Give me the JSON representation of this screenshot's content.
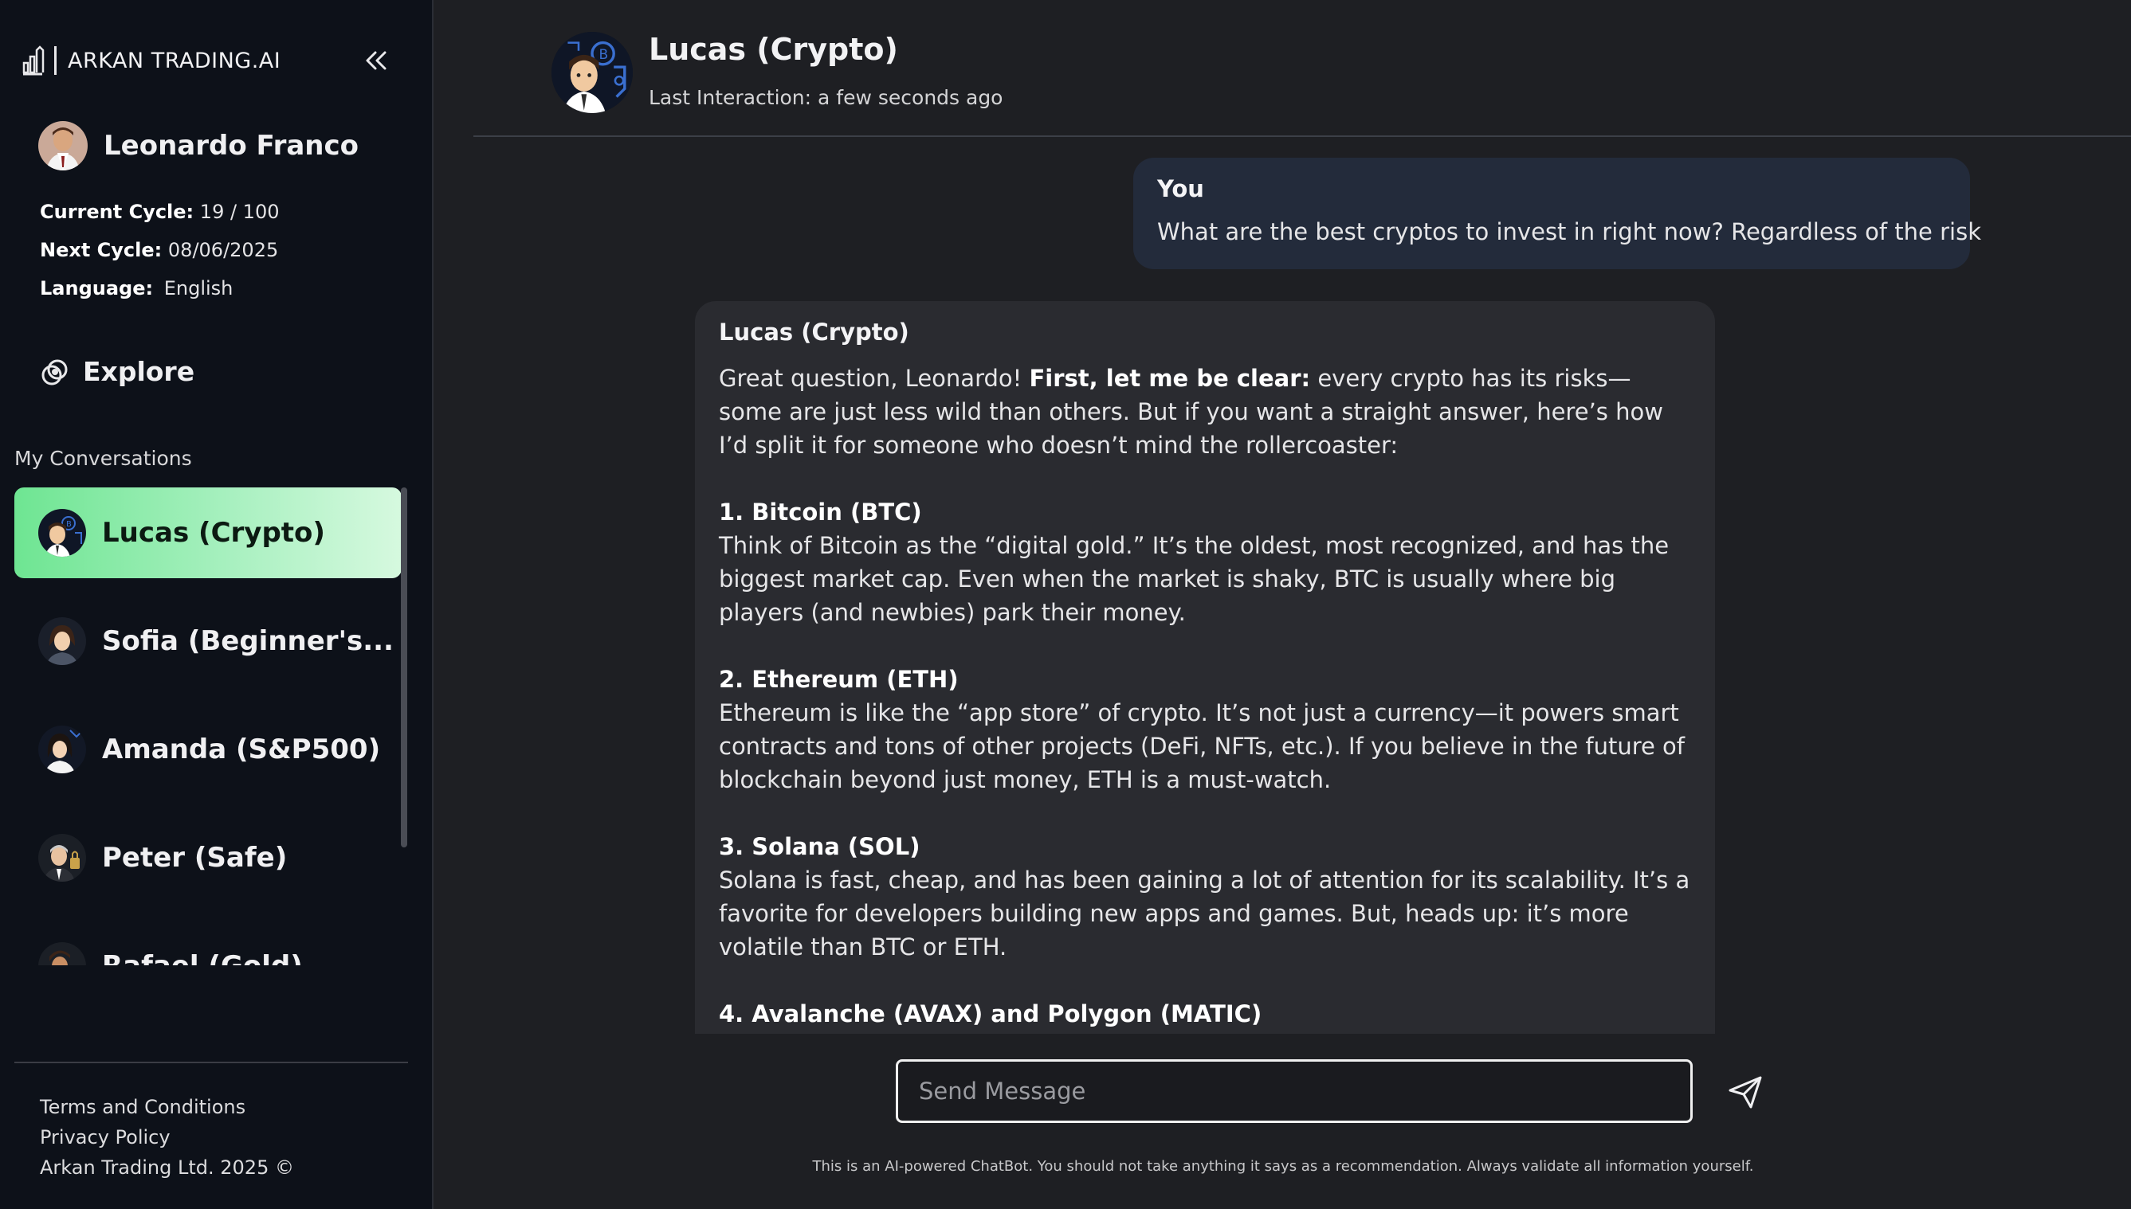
{
  "brand": {
    "name": "ARKAN TRADING.AI"
  },
  "user": {
    "name": "Leonardo Franco",
    "current_cycle_label": "Current Cycle:",
    "current_cycle_value": "19 / 100",
    "next_cycle_label": "Next Cycle:",
    "next_cycle_value": "08/06/2025",
    "language_label": "Language:",
    "language_value": "English"
  },
  "nav": {
    "explore_label": "Explore"
  },
  "conversations": {
    "heading": "My Conversations",
    "items": [
      {
        "label": "Lucas (Crypto)",
        "active": true
      },
      {
        "label": "Sofia (Beginner's...",
        "active": false
      },
      {
        "label": "Amanda (S&P500)",
        "active": false
      },
      {
        "label": "Peter (Safe)",
        "active": false
      },
      {
        "label": "Rafael (Gold)",
        "active": false
      }
    ]
  },
  "footer": {
    "terms": "Terms and Conditions",
    "privacy": "Privacy Policy",
    "copyright": "Arkan Trading Ltd. 2025 ©"
  },
  "chat": {
    "bot_name": "Lucas (Crypto)",
    "last_interaction": "Last Interaction: a few seconds ago",
    "user_message": {
      "author": "You",
      "text": "What are the best cryptos to invest in right now? Regardless of the risk"
    },
    "bot_message": {
      "author": "Lucas (Crypto)",
      "intro_1": "Great question, Leonardo! ",
      "intro_bold": "First, let me be clear:",
      "intro_2": " every crypto has its risks—some are just less wild than others. But if you want a straight answer, here’s how I’d split it for someone who doesn’t mind the rollercoaster:",
      "h1": "1. Bitcoin (BTC)",
      "p1": "Think of Bitcoin as the “digital gold.” It’s the oldest, most recognized, and has the biggest market cap. Even when the market is shaky, BTC is usually where big players (and newbies) park their money.",
      "h2": "2. Ethereum (ETH)",
      "p2": "Ethereum is like the “app store” of crypto. It’s not just a currency—it powers smart contracts and tons of other projects (DeFi, NFTs, etc.). If you believe in the future of blockchain beyond just money, ETH is a must-watch.",
      "h3": "3. Solana (SOL)",
      "p3": "Solana is fast, cheap, and has been gaining a lot of attention for its scalability. It’s a favorite for developers building new apps and games. But, heads up: it’s more volatile than BTC or ETH.",
      "h4": "4. Avalanche (AVAX) and Polygon (MATIC)"
    },
    "composer_placeholder": "Send Message",
    "disclaimer": "This is an AI-powered ChatBot. You should not take anything it says as a recommendation. Always validate all information yourself."
  },
  "colors": {
    "sidebar_bg": "#0d1119",
    "main_bg": "#1e1f23",
    "active_item_start": "#6ee592",
    "active_item_end": "#d6f9df",
    "user_bubble": "#232b3b",
    "bot_bubble": "#2a2b30"
  },
  "icons": {
    "brand": "chart-bars-icon",
    "collapse": "double-chevron-left-icon",
    "explore": "compass-rings-icon",
    "send": "paper-plane-icon"
  }
}
